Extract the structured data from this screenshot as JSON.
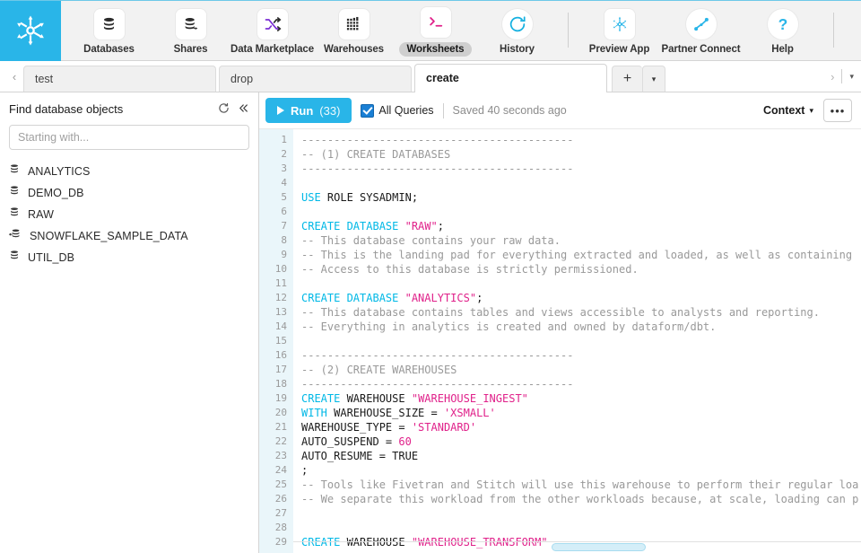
{
  "topnav": {
    "logo_icon": "snowflake-logo",
    "items": [
      {
        "label": "Databases",
        "icon": "databases-icon"
      },
      {
        "label": "Shares",
        "icon": "shares-icon"
      },
      {
        "label": "Data Marketplace",
        "icon": "data-marketplace-icon"
      },
      {
        "label": "Warehouses",
        "icon": "warehouses-icon"
      },
      {
        "label": "Worksheets",
        "icon": "worksheets-icon",
        "active": true
      },
      {
        "label": "History",
        "icon": "history-icon"
      },
      {
        "label": "Preview App",
        "icon": "preview-app-icon"
      },
      {
        "label": "Partner Connect",
        "icon": "partner-connect-icon"
      },
      {
        "label": "Help",
        "icon": "help-icon"
      }
    ]
  },
  "tabbar": {
    "prev_arrow": "‹",
    "next_arrow": "›",
    "add_label": "+",
    "add_caret": "▾",
    "overflow_caret": "▾",
    "tabs": [
      {
        "label": "test",
        "active": false
      },
      {
        "label": "drop",
        "active": false
      },
      {
        "label": "create",
        "active": true
      }
    ]
  },
  "sidebar": {
    "title": "Find database objects",
    "refresh_icon": "refresh-icon",
    "collapse_icon": "collapse-icon",
    "search_placeholder": "Starting with...",
    "search_value": "",
    "databases": [
      {
        "name": "ANALYTICS",
        "icon": "database-icon",
        "shared": false
      },
      {
        "name": "DEMO_DB",
        "icon": "database-icon",
        "shared": false
      },
      {
        "name": "RAW",
        "icon": "database-icon",
        "shared": false
      },
      {
        "name": "SNOWFLAKE_SAMPLE_DATA",
        "icon": "shared-database-icon",
        "shared": true
      },
      {
        "name": "UTIL_DB",
        "icon": "database-icon",
        "shared": false
      }
    ]
  },
  "toolbar": {
    "run_label": "Run",
    "run_count": "(33)",
    "play_icon": "play-icon",
    "all_queries_label": "All Queries",
    "all_queries_checked": true,
    "saved_status": "Saved 40 seconds ago",
    "context_label": "Context",
    "context_caret": "▾",
    "more_label": "•••"
  },
  "editor": {
    "first_line": 1,
    "lines": [
      {
        "n": 1,
        "tokens": [
          {
            "t": "cmt",
            "s": "------------------------------------------"
          }
        ]
      },
      {
        "n": 2,
        "tokens": [
          {
            "t": "cmt",
            "s": "-- (1) CREATE DATABASES"
          }
        ]
      },
      {
        "n": 3,
        "tokens": [
          {
            "t": "cmt",
            "s": "------------------------------------------"
          }
        ]
      },
      {
        "n": 4,
        "tokens": []
      },
      {
        "n": 5,
        "tokens": [
          {
            "t": "kw",
            "s": "USE"
          },
          {
            "t": "p",
            "s": " ROLE SYSADMIN;"
          }
        ]
      },
      {
        "n": 6,
        "tokens": []
      },
      {
        "n": 7,
        "tokens": [
          {
            "t": "kw",
            "s": "CREATE DATABASE"
          },
          {
            "t": "p",
            "s": " "
          },
          {
            "t": "str",
            "s": "\"RAW\""
          },
          {
            "t": "p",
            "s": ";"
          }
        ]
      },
      {
        "n": 8,
        "tokens": [
          {
            "t": "cmt",
            "s": "-- This database contains your raw data."
          }
        ]
      },
      {
        "n": 9,
        "tokens": [
          {
            "t": "cmt",
            "s": "-- This is the landing pad for everything extracted and loaded, as well as containing"
          }
        ]
      },
      {
        "n": 10,
        "tokens": [
          {
            "t": "cmt",
            "s": "-- Access to this database is strictly permissioned."
          }
        ]
      },
      {
        "n": 11,
        "tokens": []
      },
      {
        "n": 12,
        "tokens": [
          {
            "t": "kw",
            "s": "CREATE DATABASE"
          },
          {
            "t": "p",
            "s": " "
          },
          {
            "t": "str",
            "s": "\"ANALYTICS\""
          },
          {
            "t": "p",
            "s": ";"
          }
        ]
      },
      {
        "n": 13,
        "tokens": [
          {
            "t": "cmt",
            "s": "-- This database contains tables and views accessible to analysts and reporting."
          }
        ]
      },
      {
        "n": 14,
        "tokens": [
          {
            "t": "cmt",
            "s": "-- Everything in analytics is created and owned by dataform/dbt."
          }
        ]
      },
      {
        "n": 15,
        "tokens": []
      },
      {
        "n": 16,
        "tokens": [
          {
            "t": "cmt",
            "s": "------------------------------------------"
          }
        ]
      },
      {
        "n": 17,
        "tokens": [
          {
            "t": "cmt",
            "s": "-- (2) CREATE WAREHOUSES"
          }
        ]
      },
      {
        "n": 18,
        "tokens": [
          {
            "t": "cmt",
            "s": "------------------------------------------"
          }
        ]
      },
      {
        "n": 19,
        "tokens": [
          {
            "t": "kw",
            "s": "CREATE"
          },
          {
            "t": "p",
            "s": " WAREHOUSE "
          },
          {
            "t": "str",
            "s": "\"WAREHOUSE_INGEST\""
          }
        ]
      },
      {
        "n": 20,
        "tokens": [
          {
            "t": "kw",
            "s": "WITH"
          },
          {
            "t": "p",
            "s": " WAREHOUSE_SIZE = "
          },
          {
            "t": "str",
            "s": "'XSMALL'"
          }
        ]
      },
      {
        "n": 21,
        "tokens": [
          {
            "t": "p",
            "s": "WAREHOUSE_TYPE = "
          },
          {
            "t": "str",
            "s": "'STANDARD'"
          }
        ]
      },
      {
        "n": 22,
        "tokens": [
          {
            "t": "p",
            "s": "AUTO_SUSPEND = "
          },
          {
            "t": "num",
            "s": "60"
          }
        ]
      },
      {
        "n": 23,
        "tokens": [
          {
            "t": "p",
            "s": "AUTO_RESUME = TRUE"
          }
        ]
      },
      {
        "n": 24,
        "tokens": [
          {
            "t": "p",
            "s": ";"
          }
        ]
      },
      {
        "n": 25,
        "tokens": [
          {
            "t": "cmt",
            "s": "-- Tools like Fivetran and Stitch will use this warehouse to perform their regular loa"
          }
        ]
      },
      {
        "n": 26,
        "tokens": [
          {
            "t": "cmt",
            "s": "-- We separate this workload from the other workloads because, at scale, loading can p"
          }
        ]
      },
      {
        "n": 27,
        "tokens": []
      },
      {
        "n": 28,
        "tokens": []
      },
      {
        "n": 29,
        "tokens": [
          {
            "t": "kw",
            "s": "CREATE"
          },
          {
            "t": "p",
            "s": " WAREHOUSE "
          },
          {
            "t": "str",
            "s": "\"WAREHOUSE_TRANSFORM\""
          }
        ]
      }
    ]
  },
  "colors": {
    "brand_blue": "#29b5e8",
    "keyword": "#00b8e6",
    "string": "#e0218a",
    "comment": "#999999",
    "gutter_bg": "#eaf6fa"
  }
}
